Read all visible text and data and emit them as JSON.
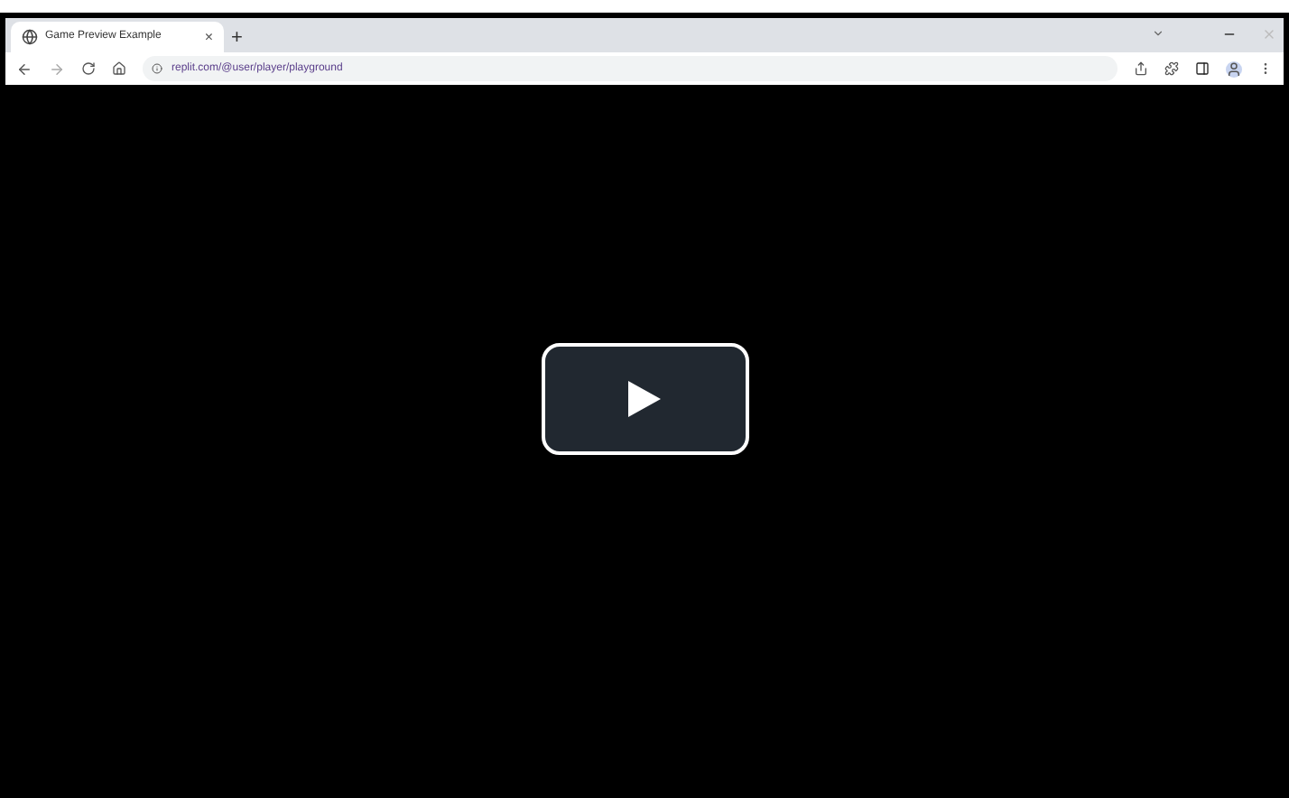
{
  "tab": {
    "title": "Game Preview Example",
    "close": "×",
    "new_tab": "+"
  },
  "address_bar": {
    "url": "replit.com/@user/player/playground"
  },
  "video": {
    "playing": false
  }
}
